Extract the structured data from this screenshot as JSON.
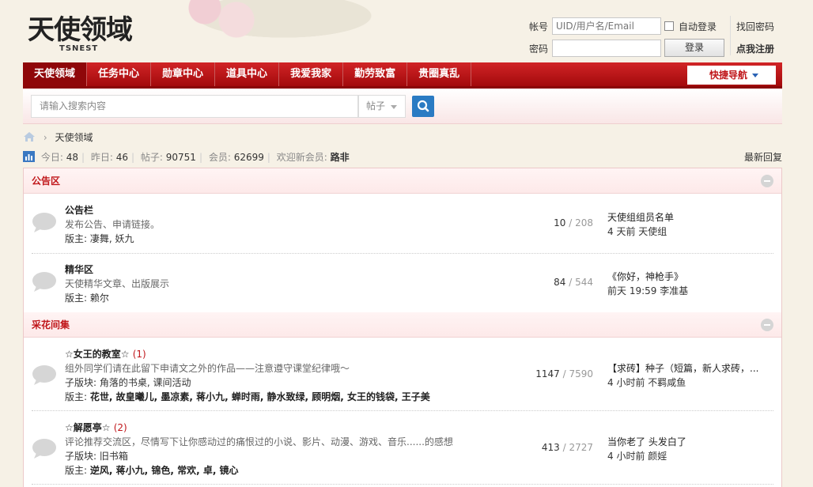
{
  "header": {
    "logo_cn": "天使领域",
    "logo_en": "TSNEST",
    "login": {
      "account_label": "帐号",
      "account_placeholder": "UID/用户名/Email",
      "auto_login": "自动登录",
      "find_password": "找回密码",
      "password_label": "密码",
      "login_button": "登录",
      "register": "点我注册"
    }
  },
  "nav": {
    "items": [
      "天使领域",
      "任务中心",
      "勋章中心",
      "道具中心",
      "我爱我家",
      "勤劳致富",
      "贵圈真乱"
    ],
    "quick_nav": "快捷导航"
  },
  "search": {
    "placeholder": "请输入搜索内容",
    "type": "帖子"
  },
  "breadcrumb": {
    "current": "天使领域"
  },
  "stats": {
    "today_label": "今日:",
    "today": "48",
    "yesterday_label": "昨日:",
    "yesterday": "46",
    "posts_label": "帖子:",
    "posts": "90751",
    "members_label": "会员:",
    "members": "62699",
    "welcome_label": "欢迎新会员:",
    "newest": "路非",
    "latest_reply": "最新回复"
  },
  "categories": [
    {
      "name": "公告区",
      "forums": [
        {
          "title": "公告栏",
          "new": "",
          "desc": "发布公告、申请链接。",
          "sub_label": "",
          "sub": "",
          "mod_label": "版主:",
          "mods": "凄舞, 妖九",
          "topics": "10",
          "posts": "208",
          "last_title": "天使组组员名单",
          "last_info": "4 天前 天使组"
        },
        {
          "title": "精华区",
          "new": "",
          "desc": "天使精华文章、出版展示",
          "sub_label": "",
          "sub": "",
          "mod_label": "版主:",
          "mods": "赖尔",
          "topics": "84",
          "posts": "544",
          "last_title": "《你好，神枪手》",
          "last_info": "前天 19:59 李准基"
        }
      ]
    },
    {
      "name": "采花间集",
      "forums": [
        {
          "title": "☆女王的教室☆",
          "new": "(1)",
          "desc": "组外同学们请在此留下申请文之外的作品——注意遵守课堂纪律哦～",
          "sub_label": "子版块:",
          "sub": "角落的书桌, 课间活动",
          "mod_label": "版主:",
          "mods": "花世, 故皇曦儿, 墨凉素, 蒋小九, 蝉时雨, 静水致绿, 顾明烟, 女王的钱袋, 王子美",
          "topics": "1147",
          "posts": "7590",
          "last_title": "【求砖】种子（短篇，新人求砖，...",
          "last_info": "4 小时前 不羁咸鱼"
        },
        {
          "title": "☆解愿亭☆",
          "new": "(2)",
          "desc": "评论推荐交流区，尽情写下让你感动过的痛恨过的小说、影片、动漫、游戏、音乐......的感想",
          "sub_label": "子版块:",
          "sub": "旧书箱",
          "mod_label": "版主:",
          "mods": "逆风, 蒋小九, 锦色, 常欢, 卓, 镜心",
          "topics": "413",
          "posts": "2727",
          "last_title": "当你老了 头发白了",
          "last_info": "4 小时前 颜婬"
        }
      ]
    }
  ]
}
